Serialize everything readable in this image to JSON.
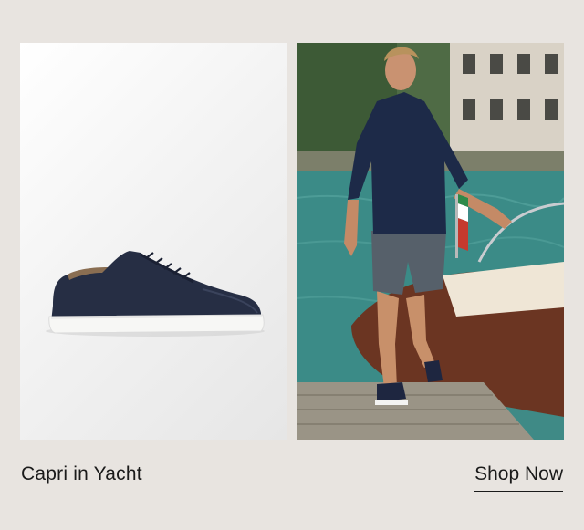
{
  "promo": {
    "caption": "Capri in Yacht",
    "cta_label": "Shop Now"
  },
  "images": {
    "product": "navy-suede-sneaker-product-photo",
    "lifestyle": "man-walking-on-dock-beside-wooden-boat"
  },
  "colors": {
    "background": "#e8e4e0",
    "text": "#1a1a1a",
    "sneaker_navy": "#232b40",
    "sole_white": "#f7f7f5"
  }
}
